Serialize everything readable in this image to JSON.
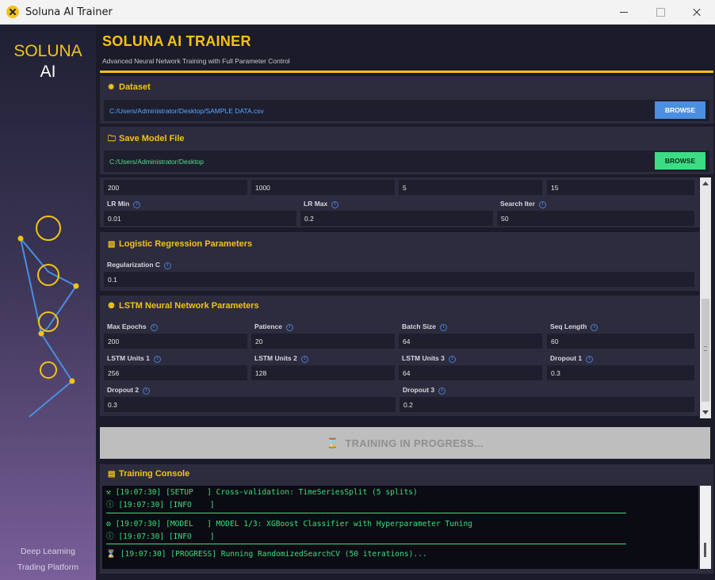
{
  "window": {
    "title": "Soluna AI Trainer"
  },
  "sidebar": {
    "brand_line1": "SOLUNA",
    "brand_line2": "AI",
    "tagline_line1": "Deep Learning",
    "tagline_line2": "Trading Platform"
  },
  "header": {
    "title": "SOLUNA AI TRAINER",
    "subtitle": "Advanced Neural Network Training with Full Parameter Control"
  },
  "dataset": {
    "title": "Dataset",
    "path": "C:/Users/Administrator/Desktop/SAMPLE DATA.csv",
    "browse_label": "BROWSE"
  },
  "save_model": {
    "title": "Save Model File",
    "path": "C:/Users/Administrator/Desktop",
    "browse_label": "BROWSE"
  },
  "xgb": {
    "row1": [
      "200",
      "1000",
      "5",
      "15"
    ],
    "labels": [
      "LR Min",
      "LR Max",
      "Search Iter"
    ],
    "values": [
      "0.01",
      "0.2",
      "50"
    ]
  },
  "logistic": {
    "title": "Logistic Regression Parameters",
    "label": "Regularization C",
    "value": "0.1"
  },
  "lstm": {
    "title": "LSTM Neural Network Parameters",
    "row1_labels": [
      "Max Epochs",
      "Patience",
      "Batch Size",
      "Seq Length"
    ],
    "row1_values": [
      "200",
      "20",
      "64",
      "60"
    ],
    "row2_labels": [
      "LSTM Units 1",
      "LSTM Units 2",
      "LSTM Units 3",
      "Dropout 1"
    ],
    "row2_values": [
      "256",
      "128",
      "64",
      "0.3"
    ],
    "row3_labels": [
      "Dropout 2",
      "Dropout 3"
    ],
    "row3_values": [
      "0.3",
      "0.2"
    ]
  },
  "training": {
    "button_label": "TRAINING IN PROGRESS..."
  },
  "console": {
    "title": "Training Console",
    "lines": [
      "[19:07:30] [SETUP   ] Cross-validation: TimeSeriesSplit (5 splits)",
      "[19:07:30] [INFO    ]",
      "[19:07:30] [MODEL   ] MODEL 1/3: XGBoost Classifier with Hyperparameter Tuning",
      "[19:07:30] [INFO    ]",
      "[19:07:30] [PROGRESS] Running RandomizedSearchCV (50 iterations)..."
    ]
  },
  "colors": {
    "accent": "#f3c317",
    "browse_blue": "#4a8fe0",
    "browse_green": "#3ddc84",
    "console_text": "#3ae07a",
    "dataset_path": "#5aa8ff",
    "save_path": "#4ee08a"
  },
  "icons": {
    "dataset": "gear-icon",
    "save": "folder-icon",
    "logistic": "chart-icon",
    "lstm": "brain-icon",
    "training": "hourglass-icon",
    "console": "terminal-icon"
  }
}
